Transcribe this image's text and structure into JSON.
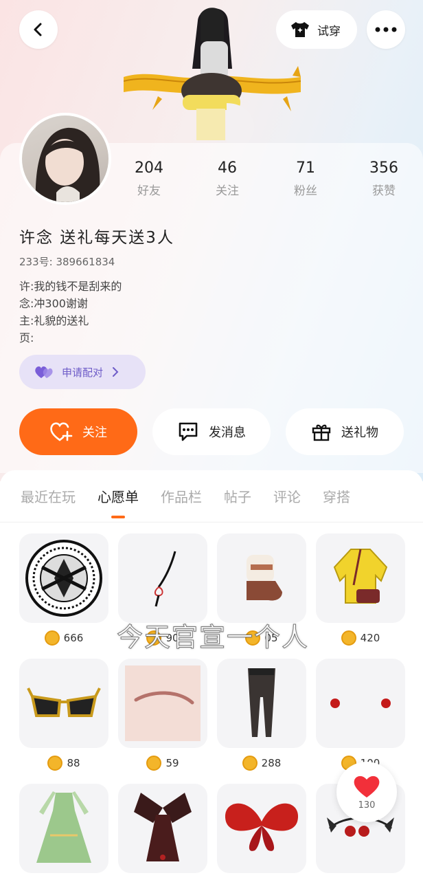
{
  "header": {
    "tryon_label": "试穿"
  },
  "profile": {
    "stats": [
      {
        "num": "204",
        "label": "好友"
      },
      {
        "num": "46",
        "label": "关注"
      },
      {
        "num": "71",
        "label": "粉丝"
      },
      {
        "num": "356",
        "label": "获赞"
      }
    ],
    "name": "许念 送礼每天送3人",
    "uid": "233号: 389661834",
    "bio": [
      "许:我的钱不是刮来的",
      "念:冲300谢谢",
      "主:礼貌的送礼",
      "页:"
    ],
    "pair_label": "申请配对"
  },
  "actions": {
    "follow": "关注",
    "message": "发消息",
    "gift": "送礼物"
  },
  "tabs": [
    "最近在玩",
    "心愿单",
    "作品栏",
    "帖子",
    "评论",
    "穿搭"
  ],
  "active_tab": "心愿单",
  "wishlist": [
    {
      "item": "round-emblem",
      "price": "666"
    },
    {
      "item": "thin-necklace",
      "price": "90"
    },
    {
      "item": "fluffy-boots",
      "price": "05"
    },
    {
      "item": "yellow-raincoat",
      "price": "420"
    },
    {
      "item": "gold-sunglasses",
      "price": "88"
    },
    {
      "item": "eyebrow",
      "price": "59"
    },
    {
      "item": "black-tights",
      "price": "288"
    },
    {
      "item": "red-earrings",
      "price": "100"
    },
    {
      "item": "green-dress",
      "price": ""
    },
    {
      "item": "butterfly-dress",
      "price": ""
    },
    {
      "item": "red-butterfly-wings",
      "price": ""
    },
    {
      "item": "butterfly-headband",
      "price": ""
    }
  ],
  "overlay_caption": "今天官宣一个人",
  "like_count": "130",
  "colors": {
    "accent": "#ff6a17",
    "pair": "#6e5cc8"
  }
}
